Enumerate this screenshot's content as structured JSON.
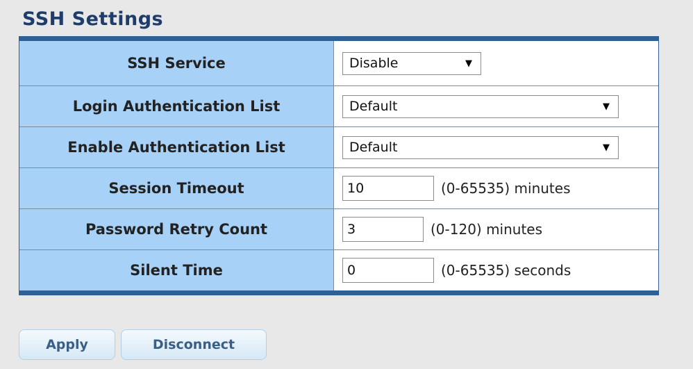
{
  "page": {
    "title": "SSH Settings"
  },
  "settings": [
    {
      "label": "SSH Service",
      "type": "select",
      "value": "Disable"
    },
    {
      "label": "Login Authentication List",
      "type": "select",
      "value": "Default"
    },
    {
      "label": "Enable Authentication List",
      "type": "select",
      "value": "Default"
    },
    {
      "label": "Session Timeout",
      "type": "input",
      "value": "10",
      "hint": "(0-65535) minutes"
    },
    {
      "label": "Password Retry Count",
      "type": "input",
      "value": "3",
      "hint": "(0-120) minutes"
    },
    {
      "label": "Silent Time",
      "type": "input",
      "value": "0",
      "hint": "(0-65535) seconds"
    }
  ],
  "buttons": {
    "apply_label": "Apply",
    "disconnect_label": "Disconnect"
  },
  "icons": {
    "dropdown": "chevron-down-icon"
  },
  "colors": {
    "title": "#1f3d6b",
    "table_border": "#2e5f95",
    "label_bg": "#a7d1f7",
    "button_text": "#3a5f85"
  }
}
